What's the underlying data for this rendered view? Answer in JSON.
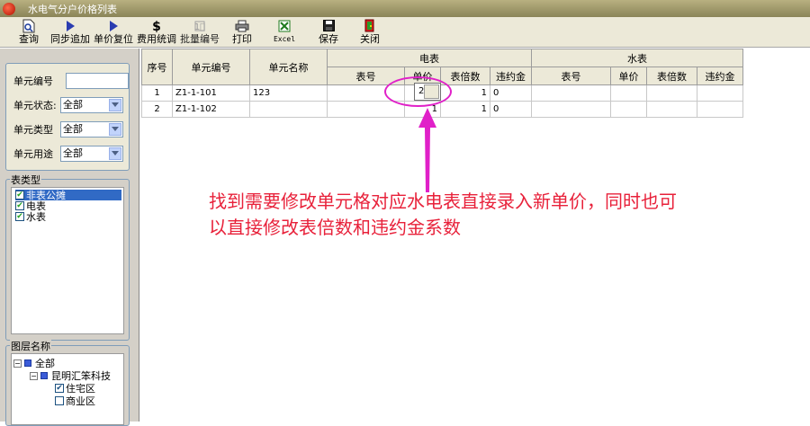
{
  "window": {
    "title": "水电气分户价格列表"
  },
  "toolbar": {
    "query": "查询",
    "sync_add": "同步追加",
    "reset_price": "单价复位",
    "fee_adjust": "费用统调",
    "batch_number": "批量编号",
    "print": "打印",
    "excel": "Excel",
    "save": "保存",
    "close": "关闭"
  },
  "filters": {
    "unit_number_label": "单元编号",
    "unit_number_value": "",
    "unit_status_label": "单元状态:",
    "unit_status_value": "全部",
    "unit_type_label": "单元类型",
    "unit_type_value": "全部",
    "unit_use_label": "单元用途",
    "unit_use_value": "全部"
  },
  "meter_types": {
    "title": "表类型",
    "items": [
      {
        "label": "非表公摊",
        "checked": true,
        "selected": true
      },
      {
        "label": "电表",
        "checked": true,
        "selected": false
      },
      {
        "label": "水表",
        "checked": true,
        "selected": false
      }
    ]
  },
  "layers": {
    "title": "图层名称",
    "root": "全部",
    "company": "昆明汇笨科技",
    "children": [
      {
        "label": "住宅区",
        "checked": true
      },
      {
        "label": "商业区",
        "checked": false
      }
    ]
  },
  "table": {
    "headers": {
      "seq": "序号",
      "unit_code": "单元编号",
      "unit_name": "单元名称",
      "electric": "电表",
      "water": "水表",
      "meter_no": "表号",
      "unit_price": "单价",
      "multiplier": "表倍数",
      "penalty": "违约金"
    },
    "rows": [
      {
        "seq": "1",
        "code": "Z1-1-101",
        "name": "123",
        "e_meter": "",
        "e_price": "2",
        "e_mult": "1",
        "e_penalty": "0",
        "w_meter": "",
        "w_price": "",
        "w_mult": "",
        "w_penalty": ""
      },
      {
        "seq": "2",
        "code": "Z1-1-102",
        "name": "",
        "e_meter": "",
        "e_price": "1",
        "e_mult": "1",
        "e_penalty": "0",
        "w_meter": "",
        "w_price": "",
        "w_mult": "",
        "w_penalty": ""
      }
    ]
  },
  "annotation": {
    "line1": "找到需要修改单元格对应水电表直接录入新单价，同时也可",
    "line2": "以直接修改表倍数和违约金系数"
  },
  "colors": {
    "annotation": "#e8213a",
    "highlight": "#e020c8",
    "arrow": "#e020c8"
  }
}
